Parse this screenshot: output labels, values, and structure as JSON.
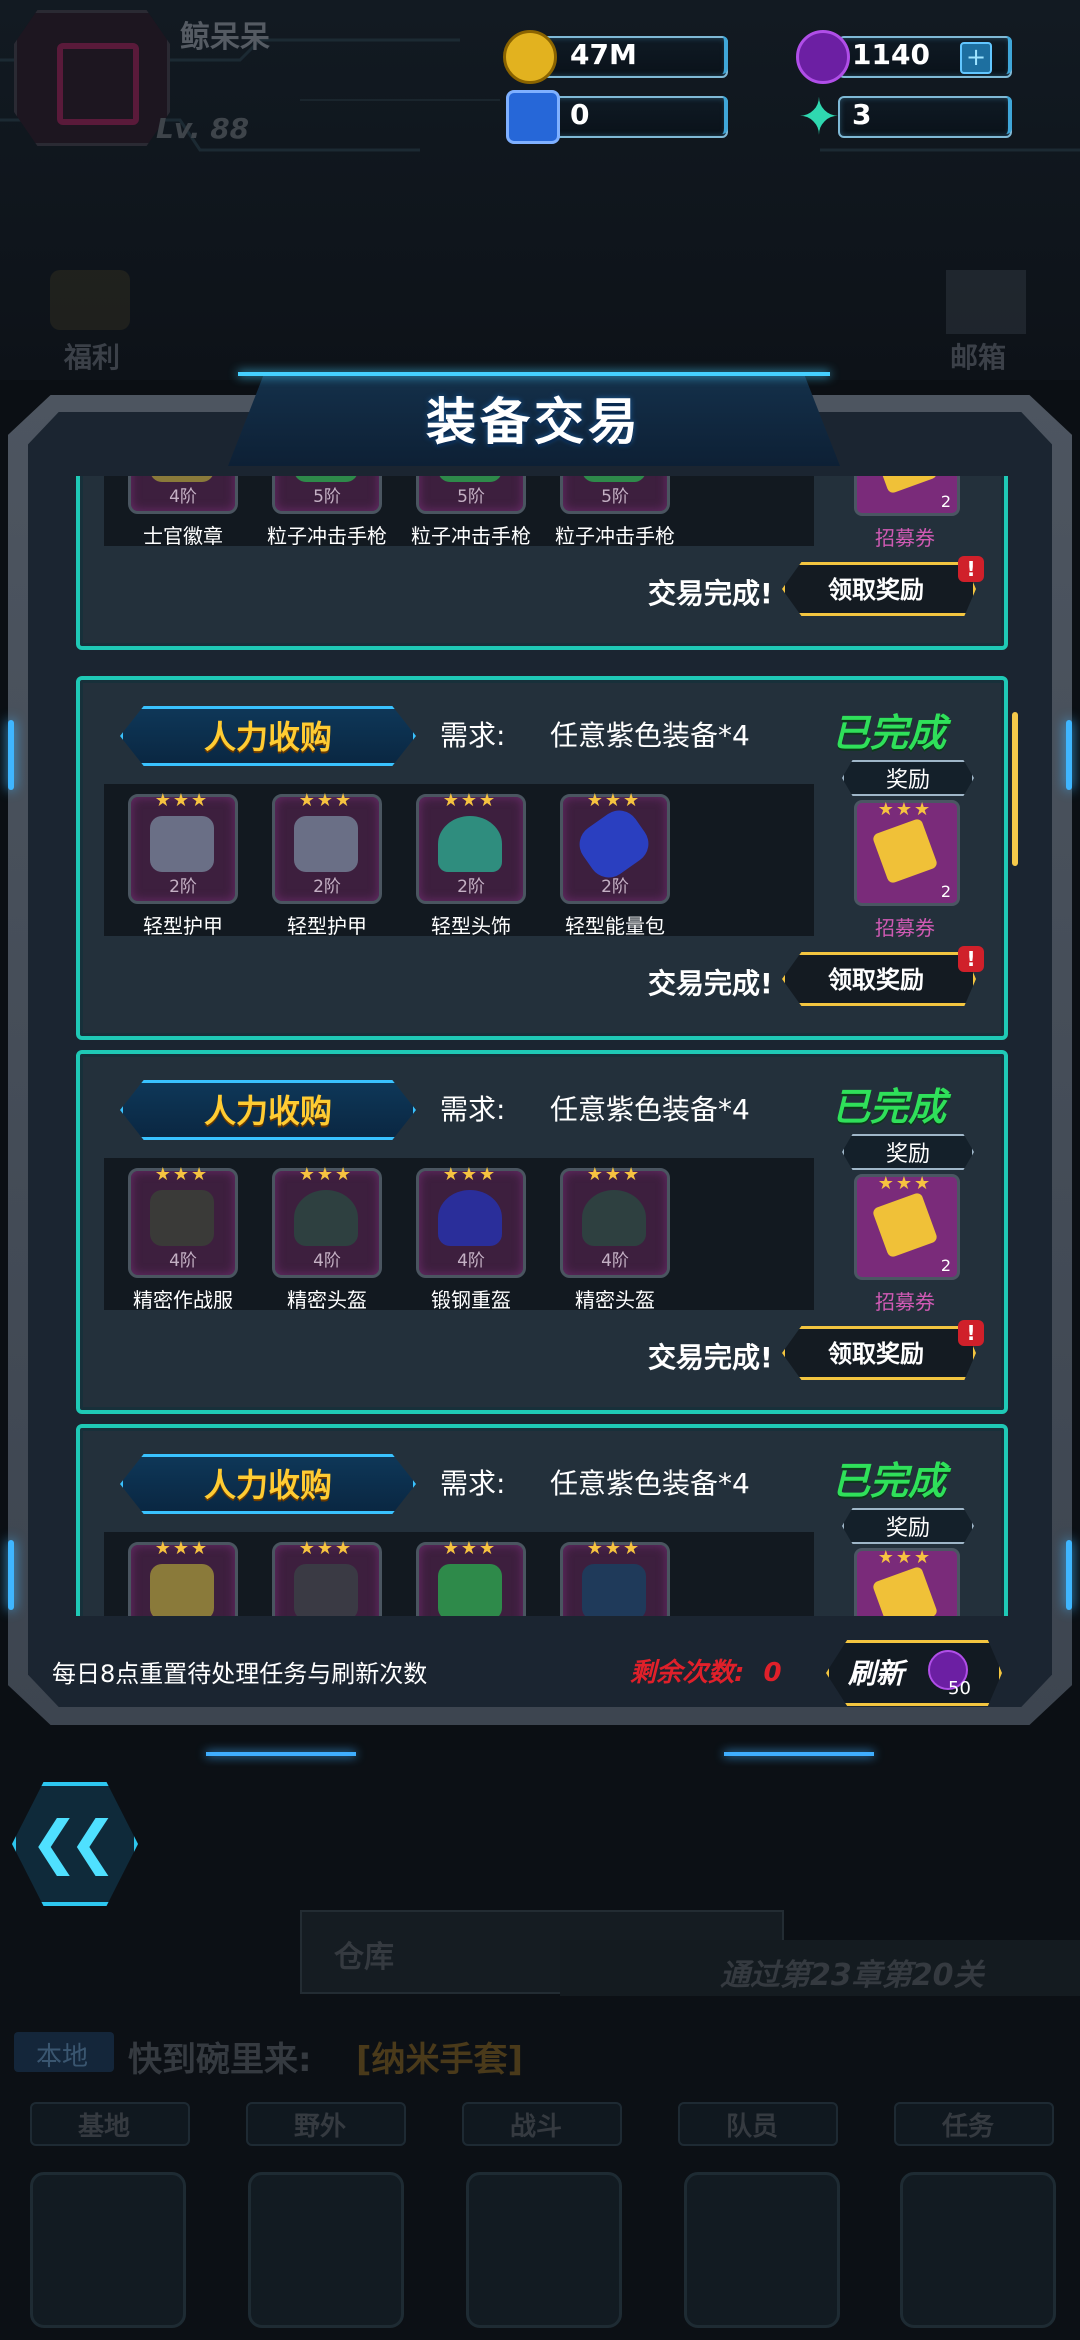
{
  "header": {
    "player_name": "鲸呆呆",
    "level": "Lv. 88",
    "gold": "47M",
    "gems": "1140",
    "blue_cubes": "0",
    "energy": "3",
    "welfare_label": "福利",
    "mail_label": "邮箱"
  },
  "dialog": {
    "title": "装备交易",
    "cards": [
      {
        "tag": "",
        "requirement_label": "",
        "requirement": "",
        "status": "",
        "reward_header": "",
        "items": [
          {
            "tier": "4阶",
            "name": "士官徽章"
          },
          {
            "tier": "5阶",
            "name": "粒子冲击手枪"
          },
          {
            "tier": "5阶",
            "name": "粒子冲击手枪"
          },
          {
            "tier": "5阶",
            "name": "粒子冲击手枪"
          }
        ],
        "reward_name": "招募券",
        "reward_count": "2",
        "complete_text": "交易完成!",
        "claim_label": "领取奖励"
      },
      {
        "tag": "人力收购",
        "requirement_label": "需求:",
        "requirement": "任意紫色装备*4",
        "status": "已完成",
        "reward_header": "奖励",
        "items": [
          {
            "tier": "2阶",
            "name": "轻型护甲"
          },
          {
            "tier": "2阶",
            "name": "轻型护甲"
          },
          {
            "tier": "2阶",
            "name": "轻型头饰"
          },
          {
            "tier": "2阶",
            "name": "轻型能量包"
          }
        ],
        "reward_name": "招募券",
        "reward_count": "2",
        "complete_text": "交易完成!",
        "claim_label": "领取奖励"
      },
      {
        "tag": "人力收购",
        "requirement_label": "需求:",
        "requirement": "任意紫色装备*4",
        "status": "已完成",
        "reward_header": "奖励",
        "items": [
          {
            "tier": "4阶",
            "name": "精密作战服"
          },
          {
            "tier": "4阶",
            "name": "精密头盔"
          },
          {
            "tier": "4阶",
            "name": "锻钢重盔"
          },
          {
            "tier": "4阶",
            "name": "精密头盔"
          }
        ],
        "reward_name": "招募券",
        "reward_count": "2",
        "complete_text": "交易完成!",
        "claim_label": "领取奖励"
      },
      {
        "tag": "人力收购",
        "requirement_label": "需求:",
        "requirement": "任意紫色装备*4",
        "status": "已完成",
        "reward_header": "奖励",
        "items": [
          {
            "tier": "",
            "name": ""
          },
          {
            "tier": "",
            "name": ""
          },
          {
            "tier": "",
            "name": ""
          },
          {
            "tier": "",
            "name": ""
          }
        ],
        "reward_name": "",
        "reward_count": "",
        "complete_text": "",
        "claim_label": ""
      }
    ],
    "footer_note": "每日8点重置待处理任务与刷新次数",
    "remaining_label": "剩余次数:",
    "remaining_value": "0",
    "refresh_label": "刷新",
    "refresh_cost": "50",
    "alert_mark": "!"
  },
  "background": {
    "warehouse_label": "仓库",
    "quest_hint": "通过第23章第20关",
    "chat_channel": "本地",
    "chat_message": "快到碗里来:",
    "chat_item": "[纳米手套]",
    "nav_tabs": [
      "基地",
      "野外",
      "战斗",
      "队员",
      "任务"
    ]
  },
  "colors": {
    "accent_teal": "#1fc9b6",
    "accent_gold": "#f3c540",
    "status_green": "#2fe05a",
    "reward_pink": "#d05ab4"
  }
}
